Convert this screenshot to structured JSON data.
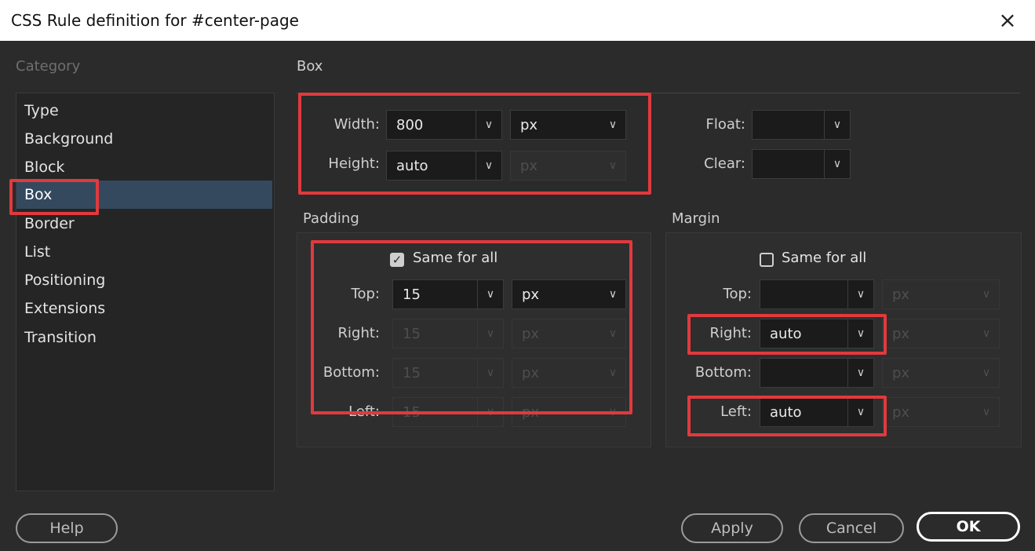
{
  "dialog": {
    "title": "CSS Rule definition for #center-page",
    "close_glyph": "×"
  },
  "category": {
    "heading": "Category",
    "items": [
      "Type",
      "Background",
      "Block",
      "Box",
      "Border",
      "List",
      "Positioning",
      "Extensions",
      "Transition"
    ],
    "selected": "Box"
  },
  "section_title": "Box",
  "size": {
    "width_label": "Width:",
    "width_value": "800",
    "width_unit": "px",
    "height_label": "Height:",
    "height_value": "auto",
    "height_unit": "px"
  },
  "float": {
    "float_label": "Float:",
    "float_value": "",
    "clear_label": "Clear:",
    "clear_value": ""
  },
  "padding": {
    "title": "Padding",
    "same_label": "Same for all",
    "same_checked": true,
    "top_label": "Top:",
    "top_value": "15",
    "top_unit": "px",
    "right_label": "Right:",
    "right_value": "15",
    "right_unit": "px",
    "bottom_label": "Bottom:",
    "bottom_value": "15",
    "bottom_unit": "px",
    "left_label": "Left:",
    "left_value": "15",
    "left_unit": "px"
  },
  "margin": {
    "title": "Margin",
    "same_label": "Same for all",
    "same_checked": false,
    "top_label": "Top:",
    "top_value": "",
    "top_unit": "px",
    "right_label": "Right:",
    "right_value": "auto",
    "right_unit": "px",
    "bottom_label": "Bottom:",
    "bottom_value": "",
    "bottom_unit": "px",
    "left_label": "Left:",
    "left_value": "auto",
    "left_unit": "px"
  },
  "buttons": {
    "help": "Help",
    "apply": "Apply",
    "cancel": "Cancel",
    "ok": "OK"
  },
  "icons": {
    "dropdown": "chevron-down-icon",
    "checkbox_checked": "checkmark-icon",
    "close": "close-icon"
  },
  "colors": {
    "highlight": "#e03a3e",
    "selection": "#34495e",
    "background": "#2b2b2b"
  }
}
